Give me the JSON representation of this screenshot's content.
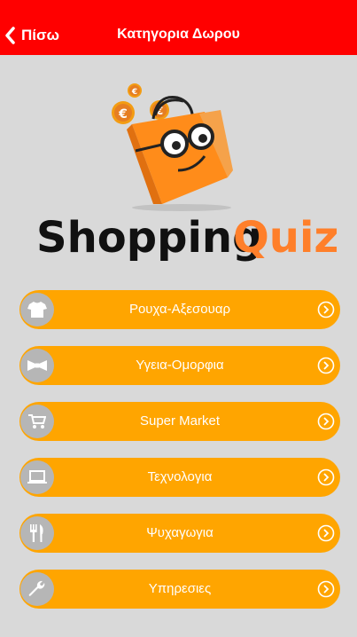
{
  "header": {
    "back_label": "Πίσω",
    "title": "Κατηγορια Δωρου"
  },
  "logo": {
    "word1": "Shopping",
    "word2": "Quiz",
    "coin_symbol": "€"
  },
  "menu": [
    {
      "label": "Ρουχα-Αξεσουαρ",
      "icon": "tshirt-icon"
    },
    {
      "label": "Υγεια-Ομορφια",
      "icon": "bowtie-icon"
    },
    {
      "label": "Super Market",
      "icon": "cart-icon"
    },
    {
      "label": "Τεχνολογια",
      "icon": "laptop-icon"
    },
    {
      "label": "Ψυχαγωγια",
      "icon": "cutlery-icon"
    },
    {
      "label": "Υπηρεσιες",
      "icon": "wrench-icon"
    }
  ],
  "colors": {
    "header": "#ff0000",
    "background": "#d9d9d9",
    "button": "#ffa500",
    "icon_circle": "#b6b6b6",
    "logo_dark": "#111111",
    "logo_accent": "#ff7f2a"
  }
}
